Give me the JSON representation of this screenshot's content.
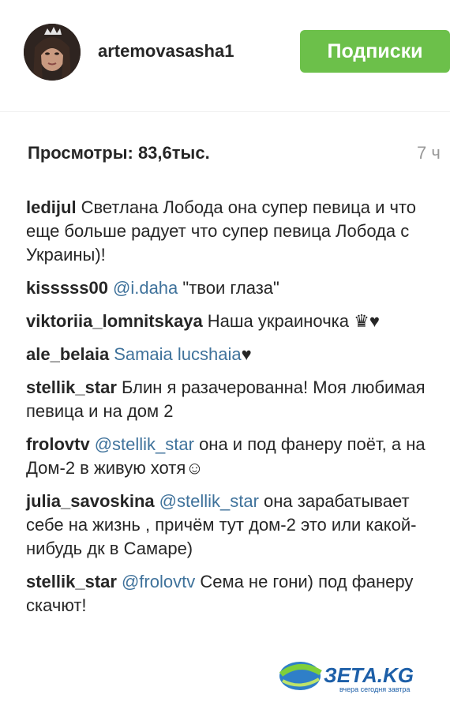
{
  "post": {
    "username": "artemovasasha1",
    "follow_button": "Подписки",
    "views": "Просмотры: 83,6тыс.",
    "time": "7 ч"
  },
  "comments": [
    {
      "user": "ledijul",
      "parts": [
        {
          "t": "Светлана Лобода она супер певица и что еще больше радует что супер певица Лобода с Украины)!"
        }
      ]
    },
    {
      "user": "kisssss00",
      "parts": [
        {
          "t": "@i.daha",
          "m": true
        },
        {
          "t": " \"твои глаза\""
        }
      ]
    },
    {
      "user": "viktoriia_lomnitskaya",
      "parts": [
        {
          "t": "Наша украиночка ♛♥"
        }
      ]
    },
    {
      "user": "ale_belaia",
      "parts": [
        {
          "t": "Samaia lucshaia",
          "m": true
        },
        {
          "t": "♥"
        }
      ]
    },
    {
      "user": "stellik_star",
      "parts": [
        {
          "t": "Блин я разачерованна! Моя любимая певица и на дом 2"
        }
      ]
    },
    {
      "user": "frolovtv",
      "parts": [
        {
          "t": "@stellik_star",
          "m": true
        },
        {
          "t": " она и под фанеру поёт, а на Дом-2 в живую хотя☺"
        }
      ]
    },
    {
      "user": "julia_savoskina",
      "parts": [
        {
          "t": "@stellik_star",
          "m": true
        },
        {
          "t": " она зарабатывает себе на жизнь , причём тут дом-2 это или какой-нибудь дк в Самаре)"
        }
      ]
    },
    {
      "user": "stellik_star",
      "parts": [
        {
          "t": "@frolovtv",
          "m": true
        },
        {
          "t": " Сема не гони) под фанеру скачют!"
        }
      ]
    }
  ],
  "watermark": {
    "text": "ЗЕТА.KG",
    "subtitle": "вчера сегодня завтра"
  }
}
